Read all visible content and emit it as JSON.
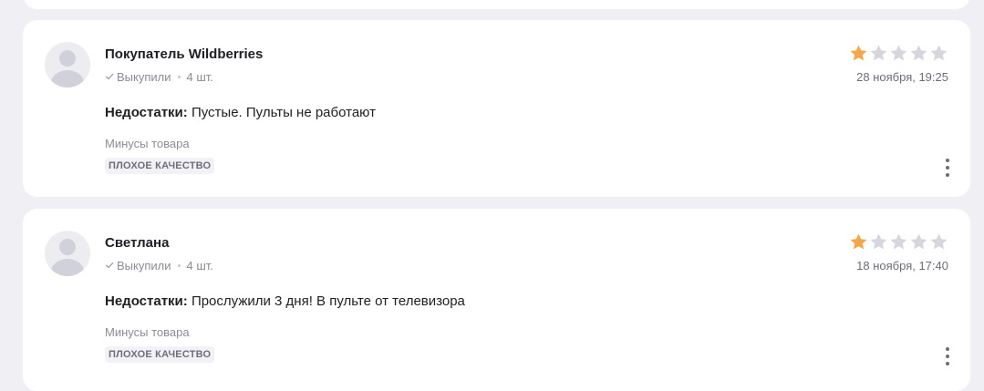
{
  "colors": {
    "page_background": "#f0f0f4",
    "card_background": "#ffffff",
    "star_filled": "#f5a64a",
    "star_empty": "#d6d6de",
    "muted_text": "#8b8b99"
  },
  "reviews": [
    {
      "author": "Покупатель Wildberries",
      "purchased_label": "Выкупили",
      "quantity": "4 шт.",
      "rating": 1,
      "max_rating": 5,
      "date": "28 ноября, 19:25",
      "cons_title": "Недостатки:",
      "cons_text": "Пустые. Пульты не работают",
      "tags_label": "Минусы товара",
      "tag": "ПЛОХОЕ КАЧЕСТВО",
      "icons": [
        "avatar-placeholder-icon",
        "check-icon",
        "star-icon",
        "more-vertical-icon"
      ]
    },
    {
      "author": "Светлана",
      "purchased_label": "Выкупили",
      "quantity": "4 шт.",
      "rating": 1,
      "max_rating": 5,
      "date": "18 ноября, 17:40",
      "cons_title": "Недостатки:",
      "cons_text": "Прослужили 3 дня! В пульте от телевизора",
      "tags_label": "Минусы товара",
      "tag": "ПЛОХОЕ КАЧЕСТВО",
      "icons": [
        "avatar-placeholder-icon",
        "check-icon",
        "star-icon",
        "more-vertical-icon"
      ]
    }
  ]
}
